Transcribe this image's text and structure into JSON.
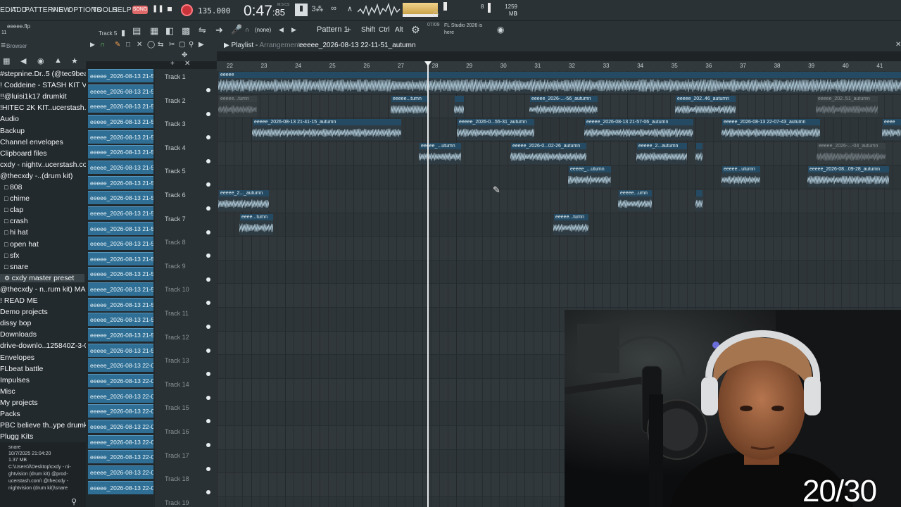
{
  "menu": [
    "EDIT",
    "ADD",
    "PATTERNS",
    "VIEW",
    "OPTIONS",
    "TOOLS",
    "HELP"
  ],
  "transport": {
    "song_mode": "SONG",
    "tempo": "135.000",
    "time_main": "0:47",
    "time_sub": ":85",
    "time_unit": "M:S:CS",
    "cpu": "8",
    "memory": "1259 MB",
    "memory_sub": "0"
  },
  "toolbar": {
    "file_name": "eeeee.flp",
    "file_sub": "11",
    "hint_track": "Track 5",
    "channel_target": "(none)",
    "pattern": "Pattern 1",
    "mod_keys": [
      "Shift",
      "Ctrl",
      "Alt"
    ],
    "news_date": "07/09",
    "news_text": "FL Studio 2026 is here"
  },
  "browser": {
    "title": "Browser",
    "items": [
      "#stepnine.Dr..5 (@tec9beat)",
      "! Coddeine - STASH KIT V2 I",
      "!!@luisi1k17 drumkit",
      "!HITEC 2K KIT..ucerstash.com",
      "Audio",
      "Backup",
      "Channel envelopes",
      "Clipboard files",
      "cxdy - nightv..ucerstash.com",
      "@thecxdy -..(drum kit)",
      "808",
      "chime",
      "clap",
      "crash",
      "hi hat",
      "open hat",
      "sfx",
      "snare",
      "cxdy master preset",
      "@thecxdy - n..rum kit) MAC",
      "! READ ME",
      "Demo projects",
      "dissy bop",
      "Downloads",
      "drive-downlo..125840Z-3-001",
      "Envelopes",
      "FLbeat battle",
      "Impulses",
      "Misc",
      "My projects",
      "Packs",
      "PBC believe th..ype drumkit 1",
      "Plugg Kits"
    ],
    "info": {
      "name": "snare",
      "date": "10/7/2025 21:04:20",
      "size": "1.37 MB",
      "path": [
        "C:\\Users\\l\\Desktop\\cxdy - ni-",
        "ghtvision (drum kit) @prod-",
        "ucerstash.com\\ @thecxdy -",
        "nightvision (drum kit)\\snare"
      ]
    }
  },
  "clip_list": [
    "eeeee_2026-08-13 21-5...",
    "eeeee_2026-08-13 21-5...",
    "eeeee_2026-08-13 21-5...",
    "eeeee_2026-08-13 21-5...",
    "eeeee_2026-08-13 21-5...",
    "eeeee_2026-08-13 21-5...",
    "eeeee_2026-08-13 21-5...",
    "eeeee_2026-08-13 21-5...",
    "eeeee_2026-08-13 21-5...",
    "eeeee_2026-08-13 21-5...",
    "eeeee_2026-08-13 21-5...",
    "eeeee_2026-08-13 21-5...",
    "eeeee_2026-08-13 21-5...",
    "eeeee_2026-08-13 21-5...",
    "eeeee_2026-08-13 21-5...",
    "eeeee_2026-08-13 21-5...",
    "eeeee_2026-08-13 21-5...",
    "eeeee_2026-08-13 21-5...",
    "eeeee_2026-08-13 21-5...",
    "eeeee_2026-08-13 22-0...",
    "eeeee_2026-08-13 22-0...",
    "eeeee_2026-08-13 22-0...",
    "eeeee_2026-08-13 22-0...",
    "eeeee_2026-08-13 22-0...",
    "eeeee_2026-08-13 22-0...",
    "eeeee_2026-08-13 22-0...",
    "eeeee_2026-08-13 22-0...",
    "eeeee_2026-08-13 22-0..."
  ],
  "playlist": {
    "title": "Playlist",
    "subtitle": "Arrangement",
    "file": "eeeee_2026-08-13 22-11-51_autumn",
    "ruler": [
      "22",
      "23",
      "24",
      "25",
      "26",
      "27",
      "28",
      "29",
      "30",
      "31",
      "32",
      "33",
      "34",
      "35",
      "36",
      "37",
      "38",
      "39",
      "40",
      "41"
    ],
    "tracks": [
      "Track 1",
      "Track 2",
      "Track 3",
      "Track 4",
      "Track 5",
      "Track 6",
      "Track 7",
      "Track 8",
      "Track 9",
      "Track 10",
      "Track 11",
      "Track 12",
      "Track 13",
      "Track 14",
      "Track 15",
      "Track 16",
      "Track 17",
      "Track 18",
      "Track 19"
    ],
    "clips": [
      {
        "label": "eeeee",
        "muted": false
      },
      {
        "label": "eeeee...tumn",
        "muted": true
      },
      {
        "label": "eeeee...tumn",
        "muted": false
      },
      {
        "label": "",
        "muted": false
      },
      {
        "label": "eeeee_2026-...-56_autumn",
        "muted": false
      },
      {
        "label": "eeeee_202..46_autumn",
        "muted": false
      },
      {
        "label": "eeeee_202..51_autumn",
        "muted": true
      },
      {
        "label": "eeeee_2026-08-13 21-41-15_autumn",
        "muted": false
      },
      {
        "label": "eeeee_2026-0...55-31_autumn",
        "muted": false
      },
      {
        "label": "eeeee_2026-08-13 21-57-06_autumn",
        "muted": false
      },
      {
        "label": "eeeee_2026-08-13 22-07-43_autumn",
        "muted": false
      },
      {
        "label": "eeee",
        "muted": false
      },
      {
        "label": "eeeee_...utumn",
        "muted": false
      },
      {
        "label": "eeeee_2026-0...02-26_autumn",
        "muted": false
      },
      {
        "label": "eeeee_2...autumn",
        "muted": false
      },
      {
        "label": "",
        "muted": false
      },
      {
        "label": "eeeee_2026-...-04_autumn",
        "muted": true
      },
      {
        "label": "eeeee_...utumn",
        "muted": false
      },
      {
        "label": "eeeee...utumn",
        "muted": false
      },
      {
        "label": "eeeee_2026-08...09-28_autumn",
        "muted": false
      },
      {
        "label": "eeeee_2..._autumn",
        "muted": false
      },
      {
        "label": "eeeee...umn",
        "muted": false
      },
      {
        "label": "",
        "muted": false
      },
      {
        "label": "eeee...tumn",
        "muted": false
      },
      {
        "label": "eeeee...tumn",
        "muted": false
      }
    ]
  },
  "overlay": {
    "counter": "20/30"
  }
}
